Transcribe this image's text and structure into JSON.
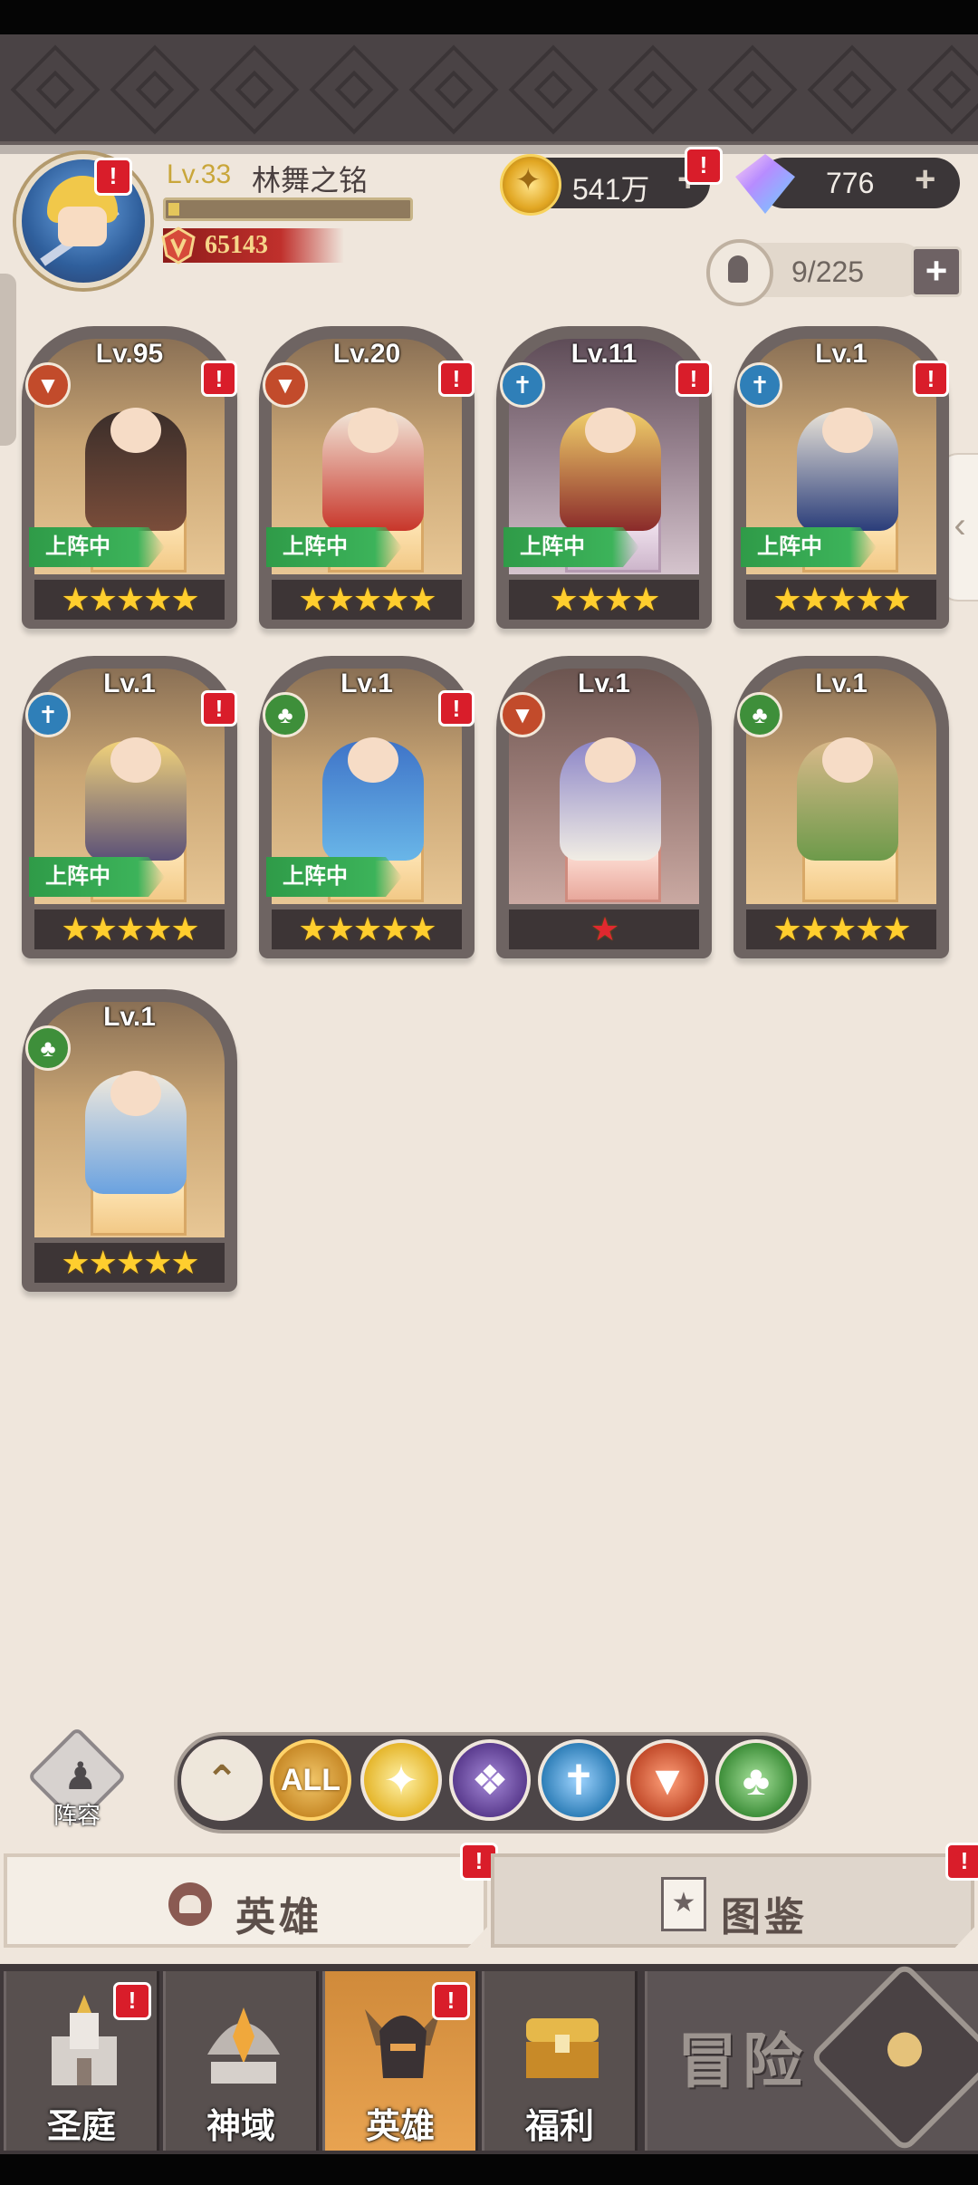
{
  "profile": {
    "level_label": "Lv.33",
    "player_name": "林舞之铭",
    "power": "65143"
  },
  "currency": {
    "gold": "541万",
    "gems": "776",
    "plus": "+"
  },
  "hero_capacity": "9/225",
  "alert_mark": "!",
  "deploy_label": "上阵中",
  "heroes": [
    {
      "level": "Lv.95",
      "element": "beast-icon",
      "stars": "★★★★★",
      "deployed": true,
      "alert": true
    },
    {
      "level": "Lv.20",
      "element": "beast-icon",
      "stars": "★★★★★",
      "deployed": true,
      "alert": true
    },
    {
      "level": "Lv.11",
      "element": "holy-icon",
      "stars": "★★★★",
      "deployed": true,
      "alert": true
    },
    {
      "level": "Lv.1",
      "element": "holy-icon",
      "stars": "★★★★★",
      "deployed": true,
      "alert": true
    },
    {
      "level": "Lv.1",
      "element": "holy-icon",
      "stars": "★★★★★",
      "deployed": true,
      "alert": true
    },
    {
      "level": "Lv.1",
      "element": "nature-icon",
      "stars": "★★★★★",
      "deployed": true,
      "alert": true
    },
    {
      "level": "Lv.1",
      "element": "beast-icon",
      "stars": "★",
      "deployed": false,
      "alert": false
    },
    {
      "level": "Lv.1",
      "element": "nature-icon",
      "stars": "★★★★★",
      "deployed": false,
      "alert": false
    },
    {
      "level": "Lv.1",
      "element": "nature-icon",
      "stars": "★★★★★",
      "deployed": false,
      "alert": false
    }
  ],
  "filter": {
    "lineup_label": "阵容",
    "all_label": "ALL",
    "selected": "ALL"
  },
  "tabs": {
    "heroes": "英雄",
    "codex": "图鉴"
  },
  "bottom_nav": {
    "items": [
      "圣庭",
      "神域",
      "英雄",
      "福利"
    ],
    "active": "英雄",
    "adventure": "冒险"
  }
}
